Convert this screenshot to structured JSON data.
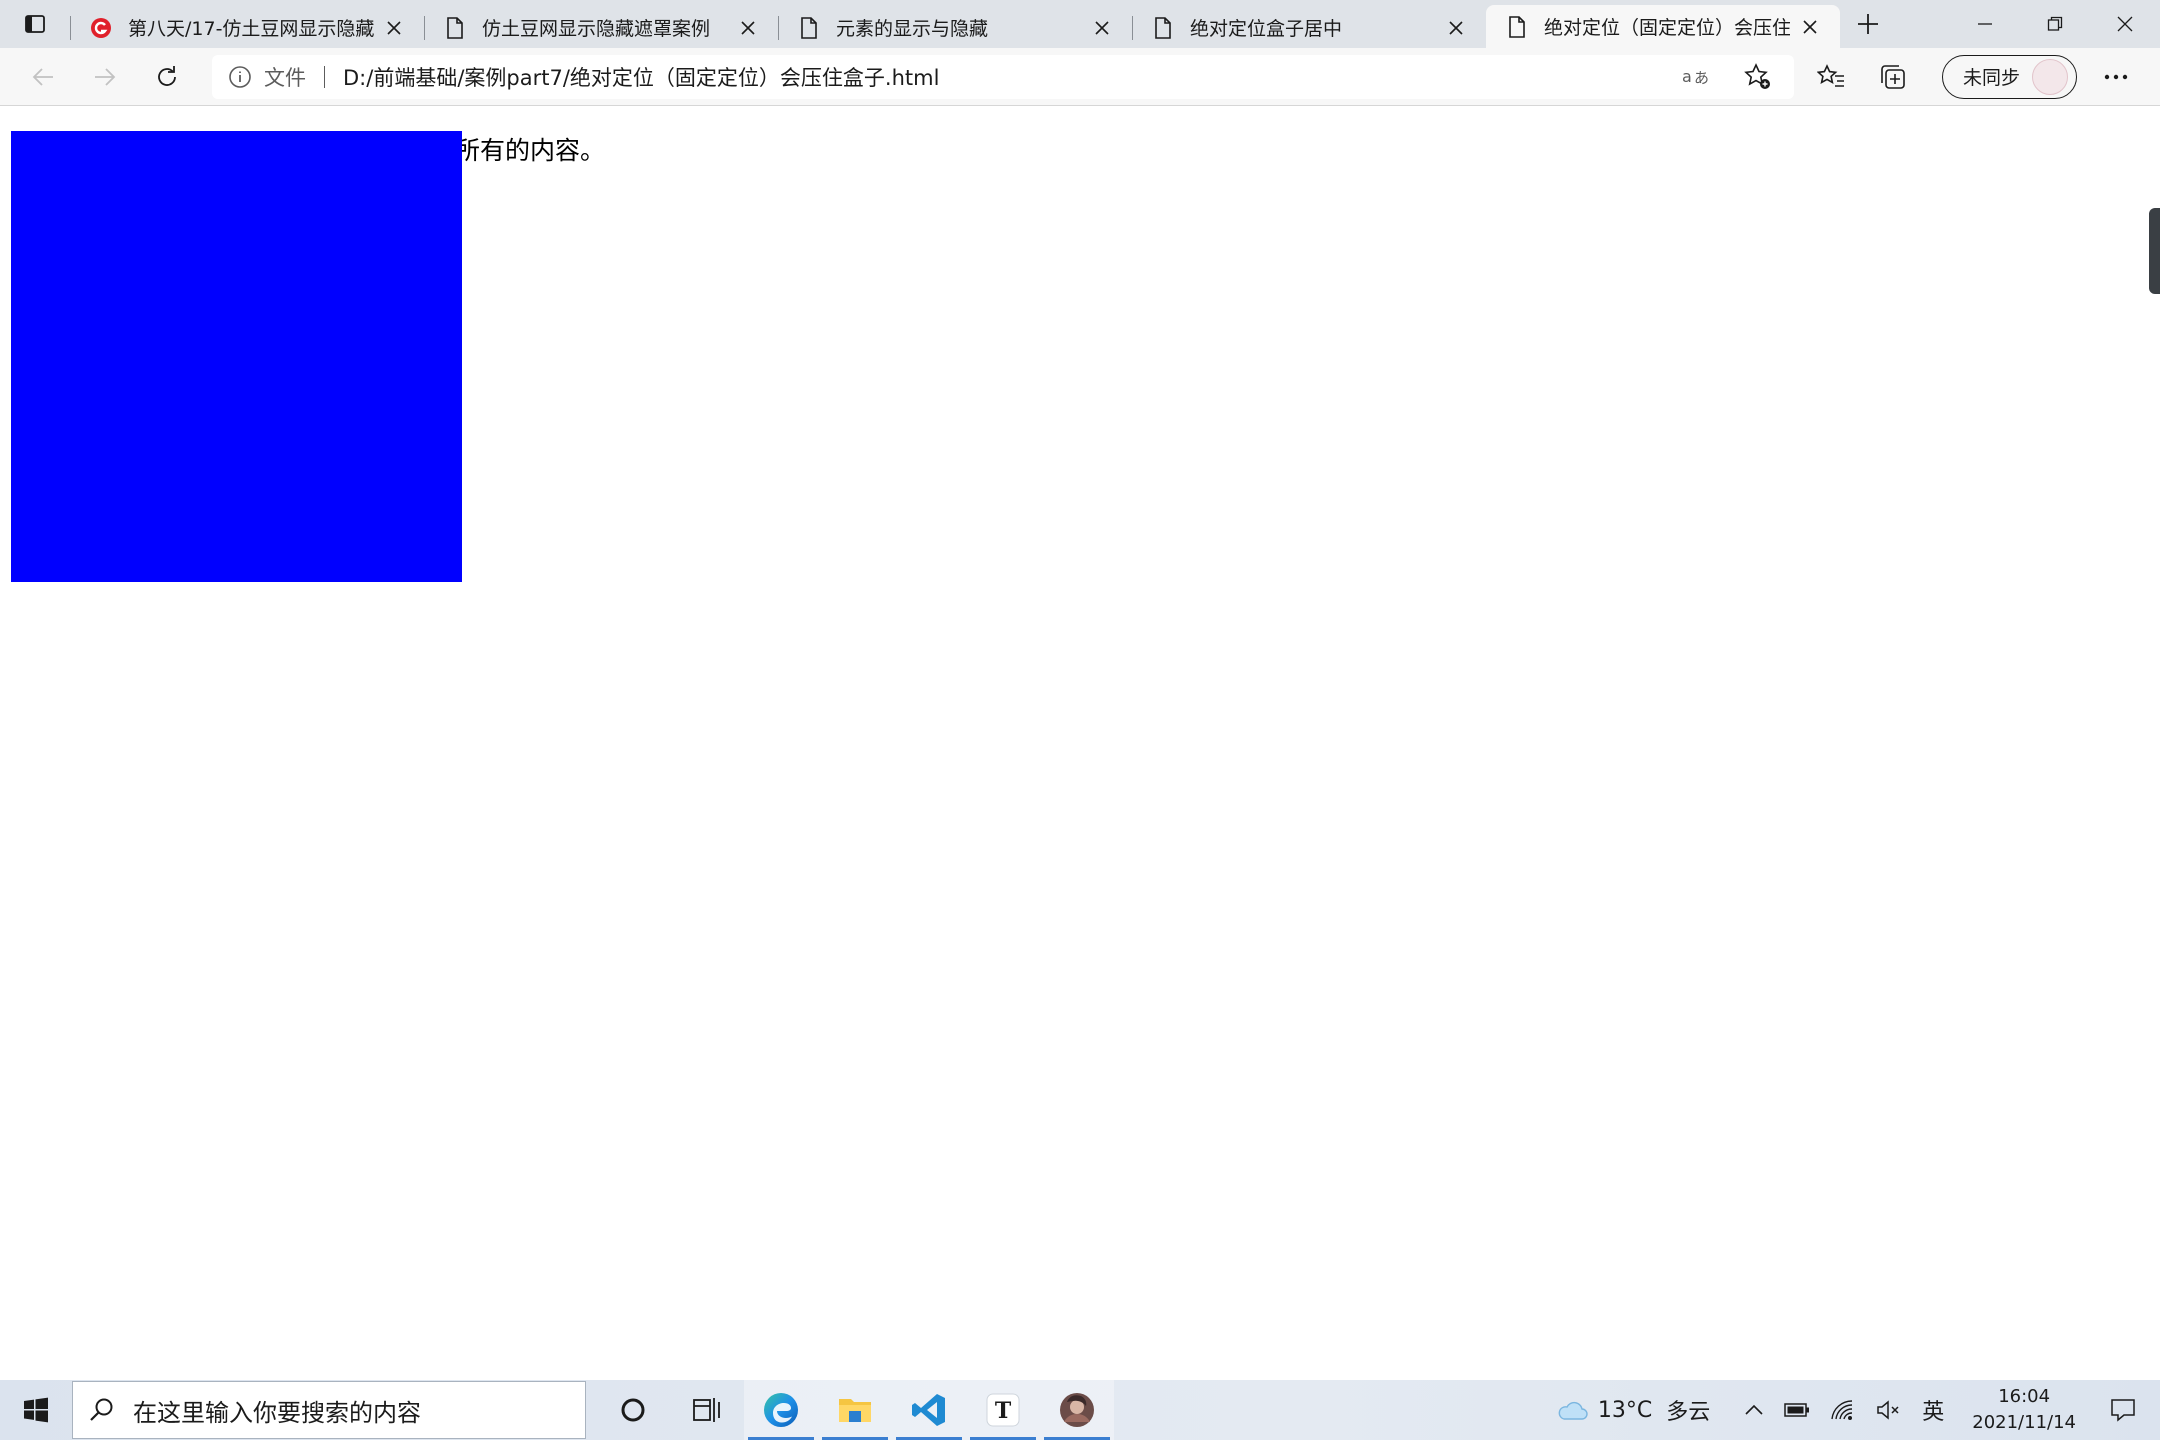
{
  "browser": {
    "tabs": [
      {
        "title": "第八天/17-仿土豆网显示隐藏遮罩",
        "icon": "site-logo-icon",
        "active": false
      },
      {
        "title": "仿土豆网显示隐藏遮罩案例",
        "icon": "file-icon",
        "active": false
      },
      {
        "title": "元素的显示与隐藏",
        "icon": "file-icon",
        "active": false
      },
      {
        "title": "绝对定位盒子居中",
        "icon": "file-icon",
        "active": false
      },
      {
        "title": "绝对定位（固定定位）会压住盒",
        "icon": "file-icon",
        "active": true
      }
    ],
    "address": {
      "label": "文件",
      "url": "D:/前端基础/案例part7/绝对定位（固定定位）会压住盒子.html"
    },
    "profile_label": "未同步",
    "accent_color": "#0078d4"
  },
  "page": {
    "visible_text": "所有的内容。",
    "box_color": "#0000ff"
  },
  "taskbar": {
    "search_placeholder": "在这里输入你要搜索的内容",
    "apps": [
      "cortana-icon",
      "task-view-icon",
      "edge-icon",
      "file-explorer-icon",
      "vscode-icon",
      "typora-icon",
      "photo-app-icon"
    ],
    "weather": {
      "temp": "13°C",
      "desc": "多云"
    },
    "ime": "英",
    "time": "16:04",
    "date": "2021/11/14"
  }
}
